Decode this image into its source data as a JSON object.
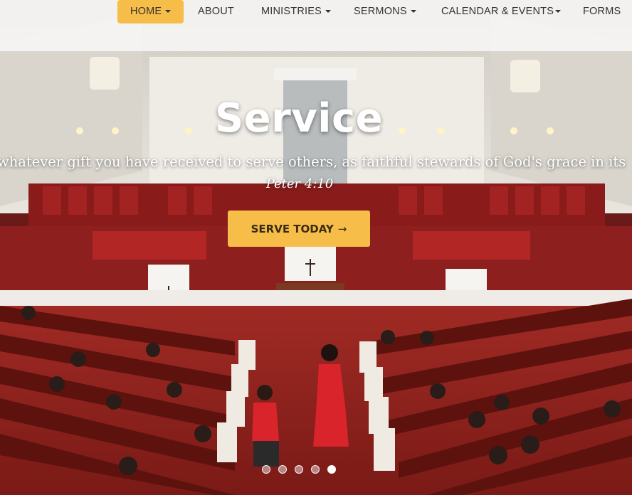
{
  "nav": {
    "items": [
      {
        "label": "HOME",
        "dropdown": true,
        "active": true
      },
      {
        "label": "ABOUT",
        "dropdown": false,
        "active": false
      },
      {
        "label": "MINISTRIES",
        "dropdown": true,
        "active": false
      },
      {
        "label": "SERMONS",
        "dropdown": true,
        "active": false
      },
      {
        "label": "CALENDAR & EVENTS",
        "dropdown": true,
        "active": false
      },
      {
        "label": "FORMS",
        "dropdown": false,
        "active": false
      }
    ]
  },
  "hero": {
    "title": "Service",
    "verse": "whatever gift you have received to serve others, as faithful stewards of God's grace in its",
    "reference": "Peter 4:10",
    "cta_label": "SERVE TODAY",
    "cta_arrow": "→"
  },
  "carousel": {
    "slide_count": 5,
    "active_index": 4
  },
  "colors": {
    "accent": "#f7bd49",
    "carpet": "#8e1f1f",
    "pew": "#6a1410",
    "wall": "#e9e6e0"
  }
}
